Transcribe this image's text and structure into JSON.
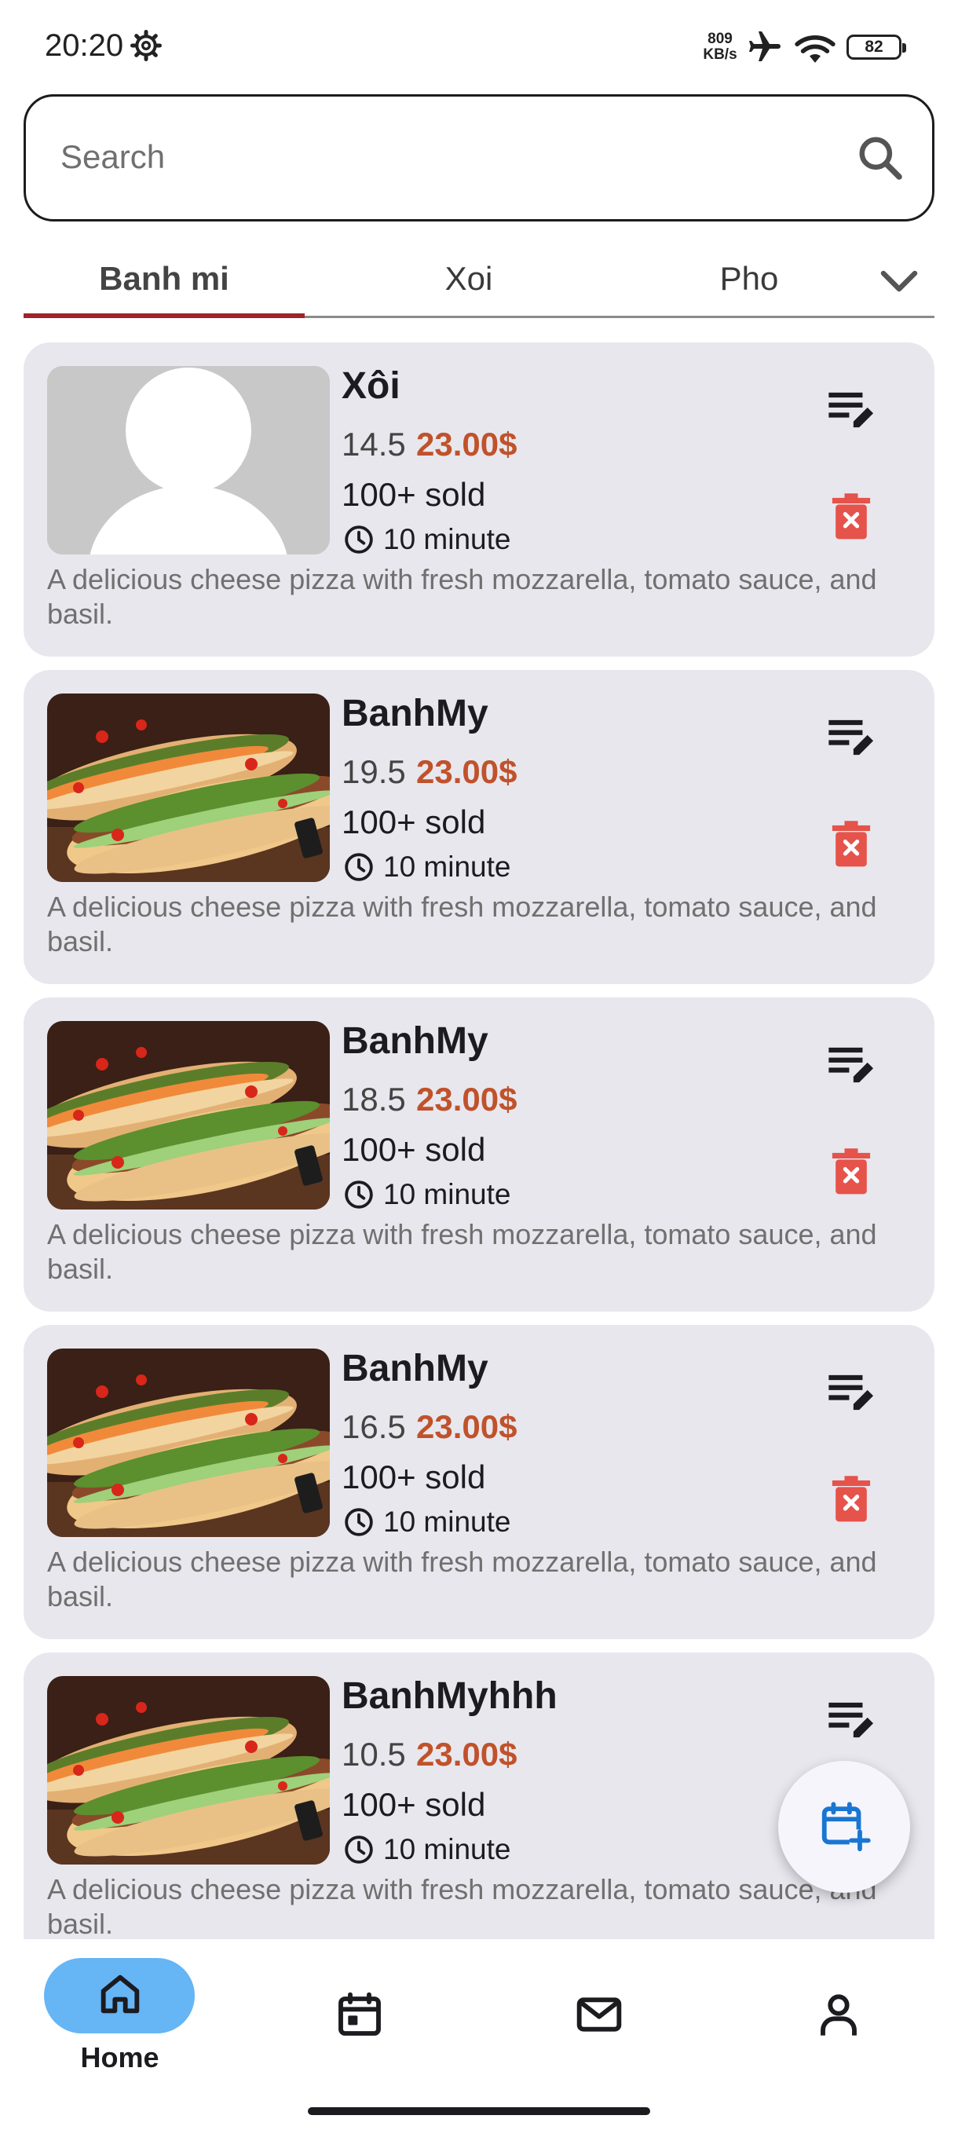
{
  "status_bar": {
    "time": "20:20",
    "net_speed_value": "809",
    "net_speed_unit": "KB/s",
    "battery": "82"
  },
  "search": {
    "placeholder": "Search",
    "value": ""
  },
  "tabs": [
    {
      "label": "Banh mi",
      "active": true
    },
    {
      "label": "Xoi",
      "active": false
    },
    {
      "label": "Pho",
      "active": false
    }
  ],
  "items": [
    {
      "name": "Xôi",
      "rating": "14.5",
      "price": "23.00$",
      "sold": "100+ sold",
      "time": "10 minute",
      "description": "A delicious cheese pizza with fresh mozzarella, tomato sauce, and basil.",
      "image": "placeholder-person"
    },
    {
      "name": "BanhMy",
      "rating": "19.5",
      "price": "23.00$",
      "sold": "100+ sold",
      "time": "10 minute",
      "description": "A delicious cheese pizza with fresh mozzarella, tomato sauce, and basil.",
      "image": "banh-mi-photo"
    },
    {
      "name": "BanhMy",
      "rating": "18.5",
      "price": "23.00$",
      "sold": "100+ sold",
      "time": "10 minute",
      "description": "A delicious cheese pizza with fresh mozzarella, tomato sauce, and basil.",
      "image": "banh-mi-photo"
    },
    {
      "name": "BanhMy",
      "rating": "16.5",
      "price": "23.00$",
      "sold": "100+ sold",
      "time": "10 minute",
      "description": "A delicious cheese pizza with fresh mozzarella, tomato sauce, and basil.",
      "image": "banh-mi-photo"
    },
    {
      "name": "BanhMyhhh",
      "rating": "10.5",
      "price": "23.00$",
      "sold": "100+ sold",
      "time": "10 minute",
      "description": "A delicious cheese pizza with fresh mozzarella, tomato sauce, and basil.",
      "image": "banh-mi-photo"
    }
  ],
  "bottom_nav": [
    {
      "label": "Home",
      "icon": "home-icon",
      "active": true
    },
    {
      "label": "",
      "icon": "calendar-icon",
      "active": false
    },
    {
      "label": "",
      "icon": "mail-icon",
      "active": false
    },
    {
      "label": "",
      "icon": "person-icon",
      "active": false
    }
  ],
  "colors": {
    "accent_tab": "#a1232a",
    "price": "#c0522b",
    "delete": "#e5534b",
    "fab_icon": "#1976d2",
    "nav_active": "#66b5f5",
    "card_bg": "#e8e7ee"
  },
  "icons": [
    "settings-gear-icon",
    "airplane-icon",
    "wifi-icon",
    "search-icon",
    "chevron-down-icon",
    "edit-note-icon",
    "delete-icon",
    "clock-icon",
    "calendar-add-icon",
    "home-icon",
    "calendar-icon",
    "mail-icon",
    "person-icon"
  ]
}
